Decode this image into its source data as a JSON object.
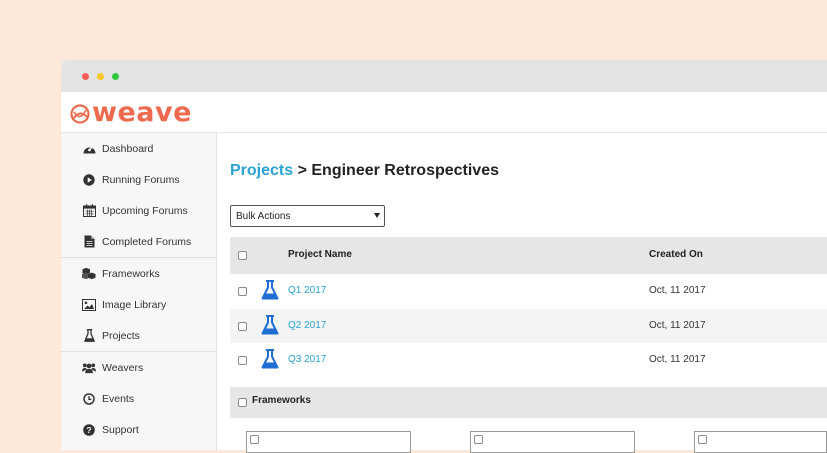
{
  "window": {
    "controls": [
      {
        "name": "close",
        "color": "#f55e57"
      },
      {
        "name": "minimize",
        "color": "#f8c62b"
      },
      {
        "name": "maximize",
        "color": "#2ccb3c"
      }
    ]
  },
  "brand": {
    "logo_text": "weave",
    "color": "#ee6a4f"
  },
  "sidebar": {
    "items": [
      {
        "label": "Dashboard",
        "icon": "tachometer-icon"
      },
      {
        "label": "Running Forums",
        "icon": "play-circle-icon"
      },
      {
        "label": "Upcoming Forums",
        "icon": "calendar-icon"
      },
      {
        "label": "Completed Forums",
        "icon": "file-icon"
      },
      {
        "label": "Frameworks",
        "icon": "cubes-icon"
      },
      {
        "label": "Image Library",
        "icon": "image-icon"
      },
      {
        "label": "Projects",
        "icon": "flask-icon"
      },
      {
        "label": "Weavers",
        "icon": "users-icon"
      },
      {
        "label": "Events",
        "icon": "clock-icon"
      },
      {
        "label": "Support",
        "icon": "question-circle-icon"
      }
    ]
  },
  "breadcrumb": {
    "parent": "Projects",
    "separator": " > ",
    "current": "Engineer Retrospectives"
  },
  "bulk_actions": {
    "selected": "Bulk Actions"
  },
  "table": {
    "columns": [
      "Project Name",
      "Created On"
    ],
    "rows": [
      {
        "name": "Q1 2017",
        "created": "Oct, 11 2017"
      },
      {
        "name": "Q2 2017",
        "created": "Oct, 11 2017"
      },
      {
        "name": "Q3 2017",
        "created": "Oct, 11 2017"
      }
    ]
  },
  "frameworks": {
    "label": "Frameworks"
  },
  "colors": {
    "link": "#29a2d6",
    "flask": "#1f6ed4",
    "header_bg": "#e6e6e6",
    "stripe": "#f4f4f4"
  }
}
